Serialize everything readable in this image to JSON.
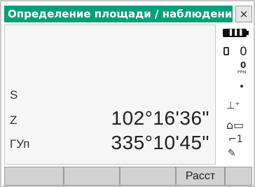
{
  "window": {
    "title": "Определение площади / наблюдения",
    "close_label": "×"
  },
  "rows": {
    "s_label": "S",
    "s_value": "",
    "z_label": "Z",
    "z_value": "102°16'36\"",
    "gup_label": "ГУп",
    "gup_value": "335°10'45\""
  },
  "status": {
    "battery_icon": "battery-icon",
    "prism_constant": "0",
    "ppm_value": "0",
    "ppm_label": "PPM",
    "laser_icon": "laser-icon",
    "tilt_icon": "tilt-icon",
    "instrument_icon": "instrument-icon",
    "face_label": "1",
    "input_mode_icon": "input-mode-icon"
  },
  "softkeys": [
    "",
    "",
    "",
    "Расст",
    ""
  ],
  "colors": {
    "title_bg": "#05a07a",
    "title_text": "#ffffff",
    "softkey_bg": "#d2d2d2"
  }
}
